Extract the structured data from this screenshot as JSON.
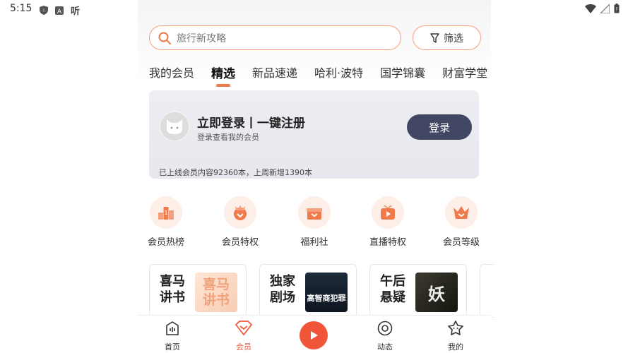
{
  "status_bar": {
    "time": "5:15",
    "listen_icon_text": "听",
    "icons_left": [
      "shield-icon",
      "a-icon"
    ],
    "icons_right": [
      "wifi-icon",
      "signal-icon",
      "battery-icon"
    ]
  },
  "search": {
    "placeholder": "旅行新攻略",
    "filter_label": "筛选"
  },
  "tabs": [
    {
      "label": "我的会员",
      "active": false
    },
    {
      "label": "精选",
      "active": true
    },
    {
      "label": "新品速递",
      "active": false
    },
    {
      "label": "哈利·波特",
      "active": false
    },
    {
      "label": "国学锦囊",
      "active": false
    },
    {
      "label": "财富学堂",
      "active": false
    }
  ],
  "login_card": {
    "title": "立即登录丨一键注册",
    "subtitle": "登录查看我的会员",
    "button": "登录",
    "stat": "已上线会员内容92360本，上周新增1390本"
  },
  "features": [
    {
      "label": "会员热榜",
      "icon": "ranking-icon"
    },
    {
      "label": "会员特权",
      "icon": "crown-badge-icon"
    },
    {
      "label": "福利社",
      "icon": "gift-icon"
    },
    {
      "label": "直播特权",
      "icon": "live-tv-icon"
    },
    {
      "label": "会员等级",
      "icon": "crown-icon"
    }
  ],
  "promo_cards": [
    {
      "title": "喜马讲书",
      "image_text": "喜马讲书"
    },
    {
      "title": "独家剧场",
      "image_text": "高智商犯罪"
    },
    {
      "title": "午后悬疑",
      "image_text": "妖"
    }
  ],
  "bottom_nav": [
    {
      "label": "首页",
      "icon": "home-icon",
      "active": false
    },
    {
      "label": "会员",
      "icon": "vip-diamond-icon",
      "active": true
    },
    {
      "label": "动态",
      "icon": "compass-icon",
      "active": false
    },
    {
      "label": "我的",
      "icon": "profile-star-icon",
      "active": false
    }
  ],
  "colors": {
    "accent": "#f05a3a",
    "login_button": "#414763"
  }
}
